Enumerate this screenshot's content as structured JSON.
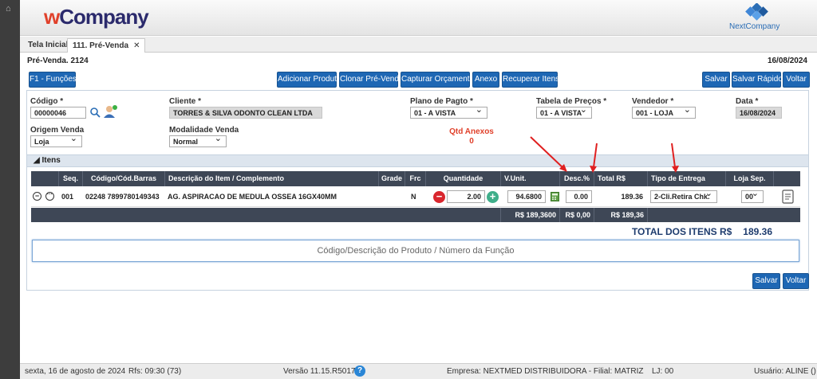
{
  "header": {
    "logo_w": "w",
    "logo_rest": "Company",
    "brand": "NextCompany"
  },
  "tabs": [
    {
      "label": "Tela Inicial"
    },
    {
      "label": "111. Pré-Venda",
      "close": "✕"
    }
  ],
  "page": {
    "title": "Pré-Venda. 2124",
    "date": "16/08/2024"
  },
  "toolbar": {
    "funcoes": "F1 - Funções",
    "adicionar": "Adicionar Produto",
    "clonar": "Clonar Pré-Venda",
    "capturar": "Capturar Orçamento",
    "anexo": "Anexo",
    "recuperar": "Recuperar Itens",
    "salvar": "Salvar",
    "salvar_rapido": "Salvar Rápido",
    "voltar": "Voltar"
  },
  "form": {
    "codigo": {
      "label": "Código *",
      "value": "00000046"
    },
    "cliente": {
      "label": "Cliente *",
      "value": "TORRES & SILVA ODONTO CLEAN LTDA"
    },
    "plano": {
      "label": "Plano de Pagto *",
      "value": "01 - A VISTA"
    },
    "tabela": {
      "label": "Tabela de Preços *",
      "value": "01 - A VISTA"
    },
    "vendedor": {
      "label": "Vendedor *",
      "value": "001 - LOJA"
    },
    "data": {
      "label": "Data *",
      "value": "16/08/2024"
    },
    "origem": {
      "label": "Origem Venda",
      "value": "Loja"
    },
    "modalidade": {
      "label": "Modalidade Venda",
      "value": "Normal"
    },
    "qtd_anexos": {
      "label": "Qtd Anexos",
      "value": "0"
    }
  },
  "itens": {
    "section_label": "Itens",
    "columns": {
      "seq": "Seq.",
      "codigo": "Código/Cód.Barras",
      "descricao": "Descrição do Item / Complemento",
      "grade": "Grade",
      "frc": "Frc",
      "quantidade": "Quantidade",
      "vunit": "V.Unit.",
      "desc": "Desc.%",
      "total": "Total R$",
      "entrega": "Tipo de Entrega",
      "loja": "Loja Sep."
    },
    "rows": [
      {
        "seq": "001",
        "codigo": "02248 7899780149343",
        "descricao": "AG. ASPIRACAO DE MEDULA OSSEA 16GX40MM",
        "frc": "N",
        "quantidade": "2.00",
        "vunit": "94.6800",
        "desc": "0.00",
        "total": "189.36",
        "entrega": "2-Cli.Retira Chk.",
        "loja": "00"
      }
    ],
    "totals": {
      "vunit": "R$ 189,3600",
      "desc": "R$ 0,00",
      "total": "R$ 189,36"
    },
    "total_label": "TOTAL DOS ITENS R$",
    "total_value": "189.36",
    "search_placeholder": "Código/Descrição do Produto / Número da Função"
  },
  "bottom": {
    "salvar": "Salvar",
    "voltar": "Voltar"
  },
  "footer": {
    "datetime": "sexta, 16 de agosto de 2024",
    "rfs": "Rfs: 09:30 (73)",
    "versao": "Versão 11.15.R5017",
    "empresa": "Empresa: NEXTMED DISTRIBUIDORA - Filial: MATRIZ",
    "lj": "LJ: 00",
    "usuario": "Usuário: ALINE ()"
  },
  "colors": {
    "button": "#1e67b4",
    "grid_header": "#3e4756",
    "accent_red": "#e0402a",
    "annotation_arrow": "#e02020"
  }
}
